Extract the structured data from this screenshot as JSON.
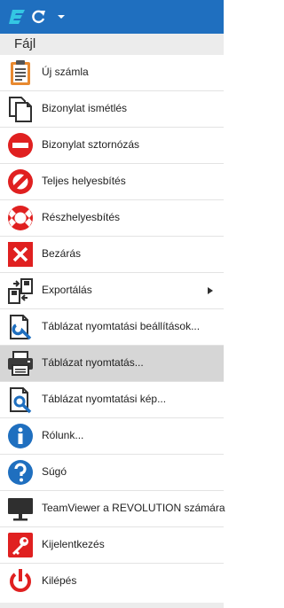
{
  "titlebar": {
    "logo_icon": "app-logo-icon",
    "refresh_icon": "refresh-icon",
    "dropdown_icon": "caret-down-icon",
    "color": "#1f6fbf"
  },
  "menu": {
    "header_label": "Fájl",
    "hover_color": "#d6d6d6",
    "items": [
      {
        "label": "Új számla",
        "icon": "clipboard-icon"
      },
      {
        "label": "Bizonylat ismétlés",
        "icon": "copy-icon"
      },
      {
        "label": "Bizonylat sztornózás",
        "icon": "no-entry-icon"
      },
      {
        "label": "Teljes helyesbítés",
        "icon": "prohibited-icon"
      },
      {
        "label": "Részhelyesbítés",
        "icon": "lifebuoy-icon"
      },
      {
        "label": "Bezárás",
        "icon": "close-icon"
      },
      {
        "label": "Exportálás",
        "icon": "export-icon",
        "has_submenu": true
      },
      {
        "label": "Táblázat nyomtatási beállítások...",
        "icon": "print-settings-icon"
      },
      {
        "label": "Táblázat nyomtatás...",
        "icon": "printer-icon",
        "hovered": true
      },
      {
        "label": "Táblázat nyomtatási kép...",
        "icon": "print-preview-icon"
      },
      {
        "label": "Rólunk...",
        "icon": "info-icon"
      },
      {
        "label": "Súgó",
        "icon": "help-icon"
      },
      {
        "label": "TeamViewer a REVOLUTION számára",
        "icon": "monitor-icon"
      },
      {
        "label": "Kijelentkezés",
        "icon": "key-icon"
      },
      {
        "label": "Kilépés",
        "icon": "power-icon"
      }
    ]
  }
}
